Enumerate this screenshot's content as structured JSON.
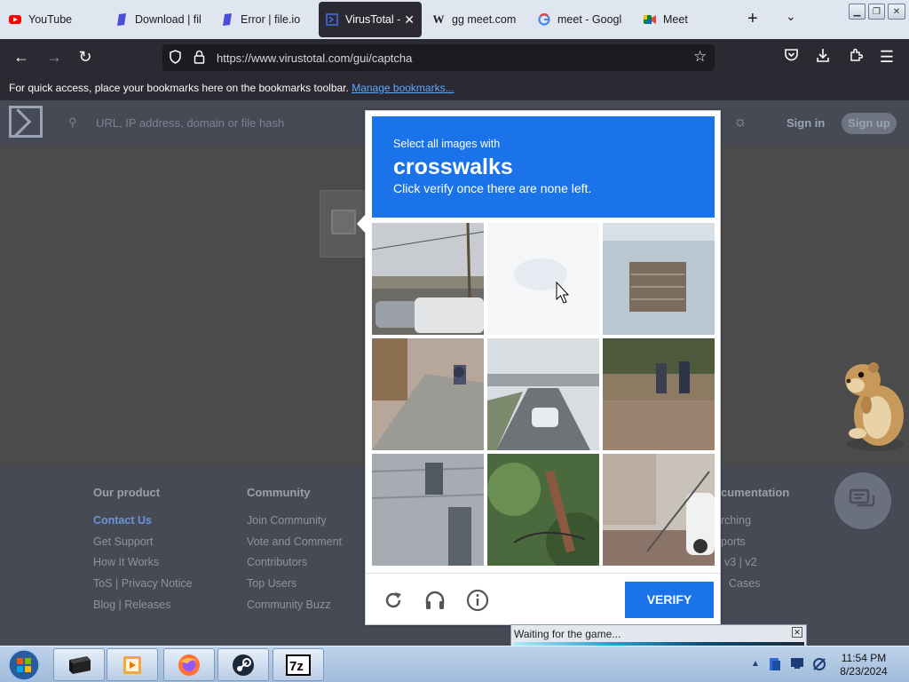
{
  "tabs": [
    {
      "label": "YouTube",
      "icon": "youtube-icon"
    },
    {
      "label": "Download | fil",
      "icon": "fileio-icon"
    },
    {
      "label": "Error | file.io",
      "icon": "fileio-icon"
    },
    {
      "label": "VirusTotal -",
      "icon": "virustotal-icon",
      "active": true
    },
    {
      "label": "gg meet.com",
      "icon": "wikipedia-icon"
    },
    {
      "label": "meet - Googl",
      "icon": "google-icon"
    },
    {
      "label": "Meet",
      "icon": "google-meet-icon"
    }
  ],
  "address_bar": {
    "url": "https://www.virustotal.com/gui/captcha"
  },
  "bookmarks_bar": {
    "message": "For quick access, place your bookmarks here on the bookmarks toolbar.",
    "link": "Manage bookmarks..."
  },
  "site_header": {
    "search_placeholder": "URL, IP address, domain or file hash",
    "sign_in": "Sign in",
    "sign_up": "Sign up"
  },
  "footer": {
    "columns": [
      {
        "heading": "Our product",
        "items": [
          "Contact Us",
          "Get Support",
          "How It Works",
          "ToS | Privacy Notice",
          "Blog | Releases"
        ]
      },
      {
        "heading": "Community",
        "items": [
          "Join Community",
          "Vote and Comment",
          "Contributors",
          "Top Users",
          "Community Buzz"
        ]
      },
      {
        "heading": "cumentation",
        "items": [
          "rching",
          "ports",
          "v3 | v2",
          "Cases"
        ]
      }
    ]
  },
  "captcha": {
    "instruction_small": "Select all images with",
    "target": "crosswalks",
    "instruction_after": "Click verify once there are none left.",
    "verify_label": "VERIFY",
    "accent_color": "#1a73e8"
  },
  "popup": {
    "text": "Waiting for the game..."
  },
  "taskbar": {
    "time": "11:54 PM",
    "date": "8/23/2024"
  }
}
